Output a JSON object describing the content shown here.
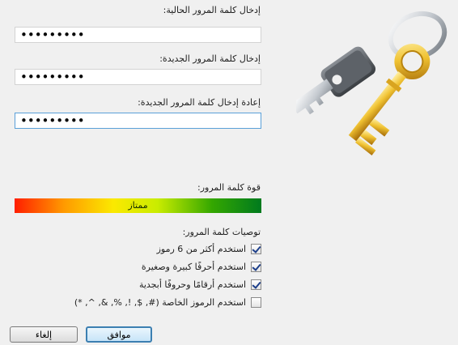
{
  "fields": [
    {
      "label": "إدخال كلمة المرور الحالية:",
      "value": "•••••••••"
    },
    {
      "label": "إدخال كلمة المرور الجديدة:",
      "value": "•••••••••"
    },
    {
      "label": "إعادة إدخال كلمة المرور الجديدة:",
      "value": "•••••••••"
    }
  ],
  "strength": {
    "label": "قوة كلمة المرور:",
    "value_text": "ممتاز",
    "level": 1.0
  },
  "recommendations": {
    "label": "توصيات كلمة المرور:",
    "items": [
      {
        "text": "استخدم أكثر من 6 رموز",
        "checked": true
      },
      {
        "text": "استخدم أحرفًا كبيرة وصغيرة",
        "checked": true
      },
      {
        "text": "استخدم أرقامًا وحروفًا أبجدية",
        "checked": true
      },
      {
        "text": "استخدم الرموز الخاصة (#, $, !, %, &, ^, *)",
        "checked": false
      }
    ]
  },
  "buttons": {
    "ok": "موافق",
    "cancel": "إلغاء"
  },
  "icons": {
    "illustration": "keys-icon"
  }
}
